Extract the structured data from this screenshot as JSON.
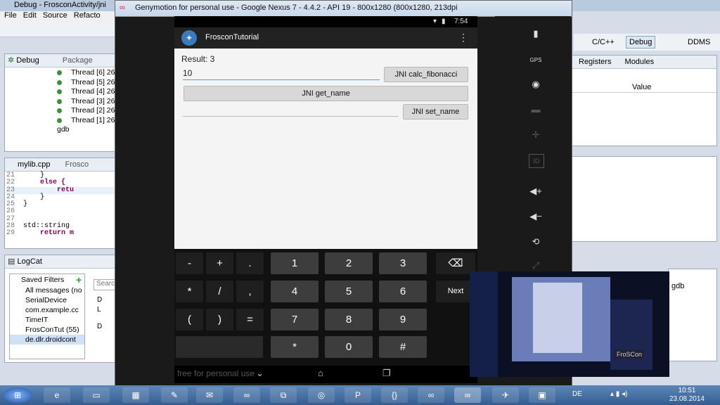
{
  "eclipse": {
    "window_title": "Debug - FrosconActivity/jni",
    "menu": [
      "File",
      "Edit",
      "Source",
      "Refacto"
    ],
    "perspectives": [
      "C/C++",
      "Debug",
      "DDMS"
    ],
    "debug_view": {
      "tabs": [
        "Debug",
        "Package"
      ],
      "threads": [
        "Thread [6] 26",
        "Thread [5] 26",
        "Thread [4] 26",
        "Thread [3] 26",
        "Thread [2] 26",
        "Thread [1] 26"
      ],
      "gdb_label": "gdb"
    },
    "editor": {
      "tabs": [
        "mylib.cpp",
        "Frosco"
      ],
      "lines": [
        {
          "n": "21",
          "code": "    }"
        },
        {
          "n": "22",
          "code": "    else {"
        },
        {
          "n": "23",
          "code": "        retu"
        },
        {
          "n": "24",
          "code": "    }"
        },
        {
          "n": "25",
          "code": "}"
        },
        {
          "n": "26",
          "code": ""
        },
        {
          "n": "27",
          "code": ""
        },
        {
          "n": "28",
          "code": "std::string"
        },
        {
          "n": "29",
          "code": "    return m"
        }
      ]
    },
    "logcat": {
      "tab": "LogCat",
      "saved_filters_label": "Saved Filters",
      "filters": [
        "All messages (no",
        "SerialDevice",
        "com.example.cc",
        "TimeIT",
        "FrosConTut (55)",
        "de.dlr.droidcont"
      ],
      "search_placeholder": "Searc",
      "levels": [
        "D",
        "L",
        "D",
        "D"
      ]
    },
    "right_panel": {
      "tabs": [
        "Registers",
        "Modules"
      ],
      "value_header": "Value",
      "gdb_label": "gdb"
    }
  },
  "emulator": {
    "title": "Genymotion for personal use - Google Nexus 7 - 4.4.2 - API 19 - 800x1280 (800x1280, 213dpi",
    "status_time": "7:54",
    "app_name": "FrosconTutorial",
    "result_text": "Result: 3",
    "input_value": "10",
    "buttons": {
      "fib": "JNI calc_fibonacci",
      "get_name": "JNI get_name",
      "set_name": "JNI set_name"
    },
    "keyboard": {
      "row1": [
        "-",
        "+",
        ".",
        "1",
        "2",
        "3",
        "⌫"
      ],
      "row2": [
        "*",
        "/",
        ",",
        "4",
        "5",
        "6",
        "Next"
      ],
      "row3": [
        "(",
        ")",
        "=",
        "7",
        "8",
        "9"
      ],
      "row4": [
        "*",
        "0",
        "#"
      ]
    },
    "watermark": "free for personal use",
    "side_labels": [
      "GPS",
      "ID"
    ]
  },
  "webcam": {
    "banner": "FroSCon"
  },
  "taskbar": {
    "lang": "DE",
    "time": "10:51",
    "date": "23.08.2014"
  }
}
